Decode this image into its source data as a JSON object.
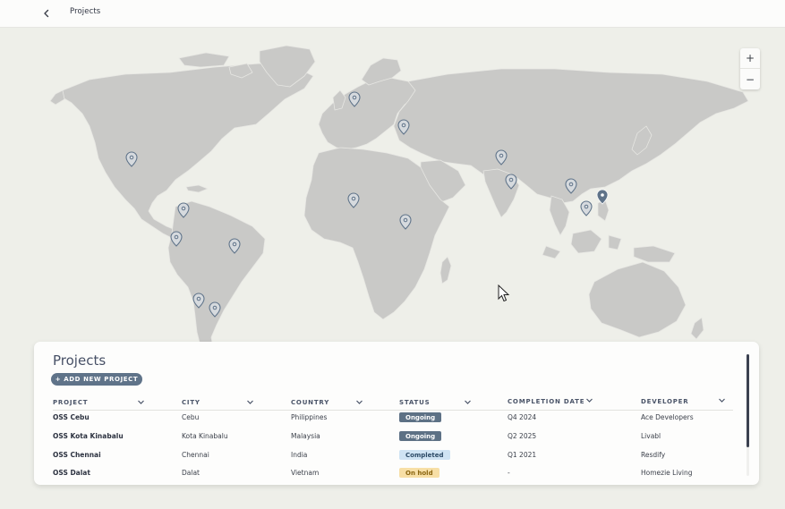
{
  "topbar": {
    "title": "Projects"
  },
  "zoom": {
    "in_label": "+",
    "out_label": "−"
  },
  "panel": {
    "title": "Projects",
    "add_button": "+ ADD NEW PROJECT",
    "columns": [
      "PROJECT",
      "CITY",
      "COUNTRY",
      "STATUS",
      "COMPLETION DATE",
      "DEVELOPER"
    ],
    "rows": [
      {
        "project": "OSS Cebu",
        "city": "Cebu",
        "country": "Philippines",
        "status": "Ongoing",
        "date": "Q4 2024",
        "developer": "Ace Developers"
      },
      {
        "project": "OSS Kota Kinabalu",
        "city": "Kota Kinabalu",
        "country": "Malaysia",
        "status": "Ongoing",
        "date": "Q2 2025",
        "developer": "Livabl"
      },
      {
        "project": "OSS Chennai",
        "city": "Chennai",
        "country": "India",
        "status": "Completed",
        "date": "Q1 2021",
        "developer": "Resdify"
      },
      {
        "project": "OSS Dalat",
        "city": "Dalat",
        "country": "Vietnam",
        "status": "On hold",
        "date": "-",
        "developer": "Homezie Living"
      }
    ]
  },
  "status_colors": {
    "Ongoing": {
      "bg": "#5d7185",
      "fg": "#ffffff"
    },
    "Completed": {
      "bg": "#cfe3f3",
      "fg": "#2c4a66"
    },
    "On hold": {
      "bg": "#f7dfa6",
      "fg": "#8a6510"
    }
  },
  "colors": {
    "land": "#c9c9c7",
    "ocean": "#eeefe9",
    "pin": "#5f7389",
    "accent": "#5f7389"
  },
  "map": {
    "markers": [
      {
        "name": "Mexico"
      },
      {
        "name": "Colombia"
      },
      {
        "name": "Peru"
      },
      {
        "name": "Brazil"
      },
      {
        "name": "Chile"
      },
      {
        "name": "Argentina"
      },
      {
        "name": "Netherlands"
      },
      {
        "name": "Turkey"
      },
      {
        "name": "Nigeria"
      },
      {
        "name": "Tanzania"
      },
      {
        "name": "Delhi"
      },
      {
        "name": "Chennai"
      },
      {
        "name": "Dalat"
      },
      {
        "name": "Kota Kinabalu"
      },
      {
        "name": "Cebu",
        "selected": true
      }
    ]
  }
}
